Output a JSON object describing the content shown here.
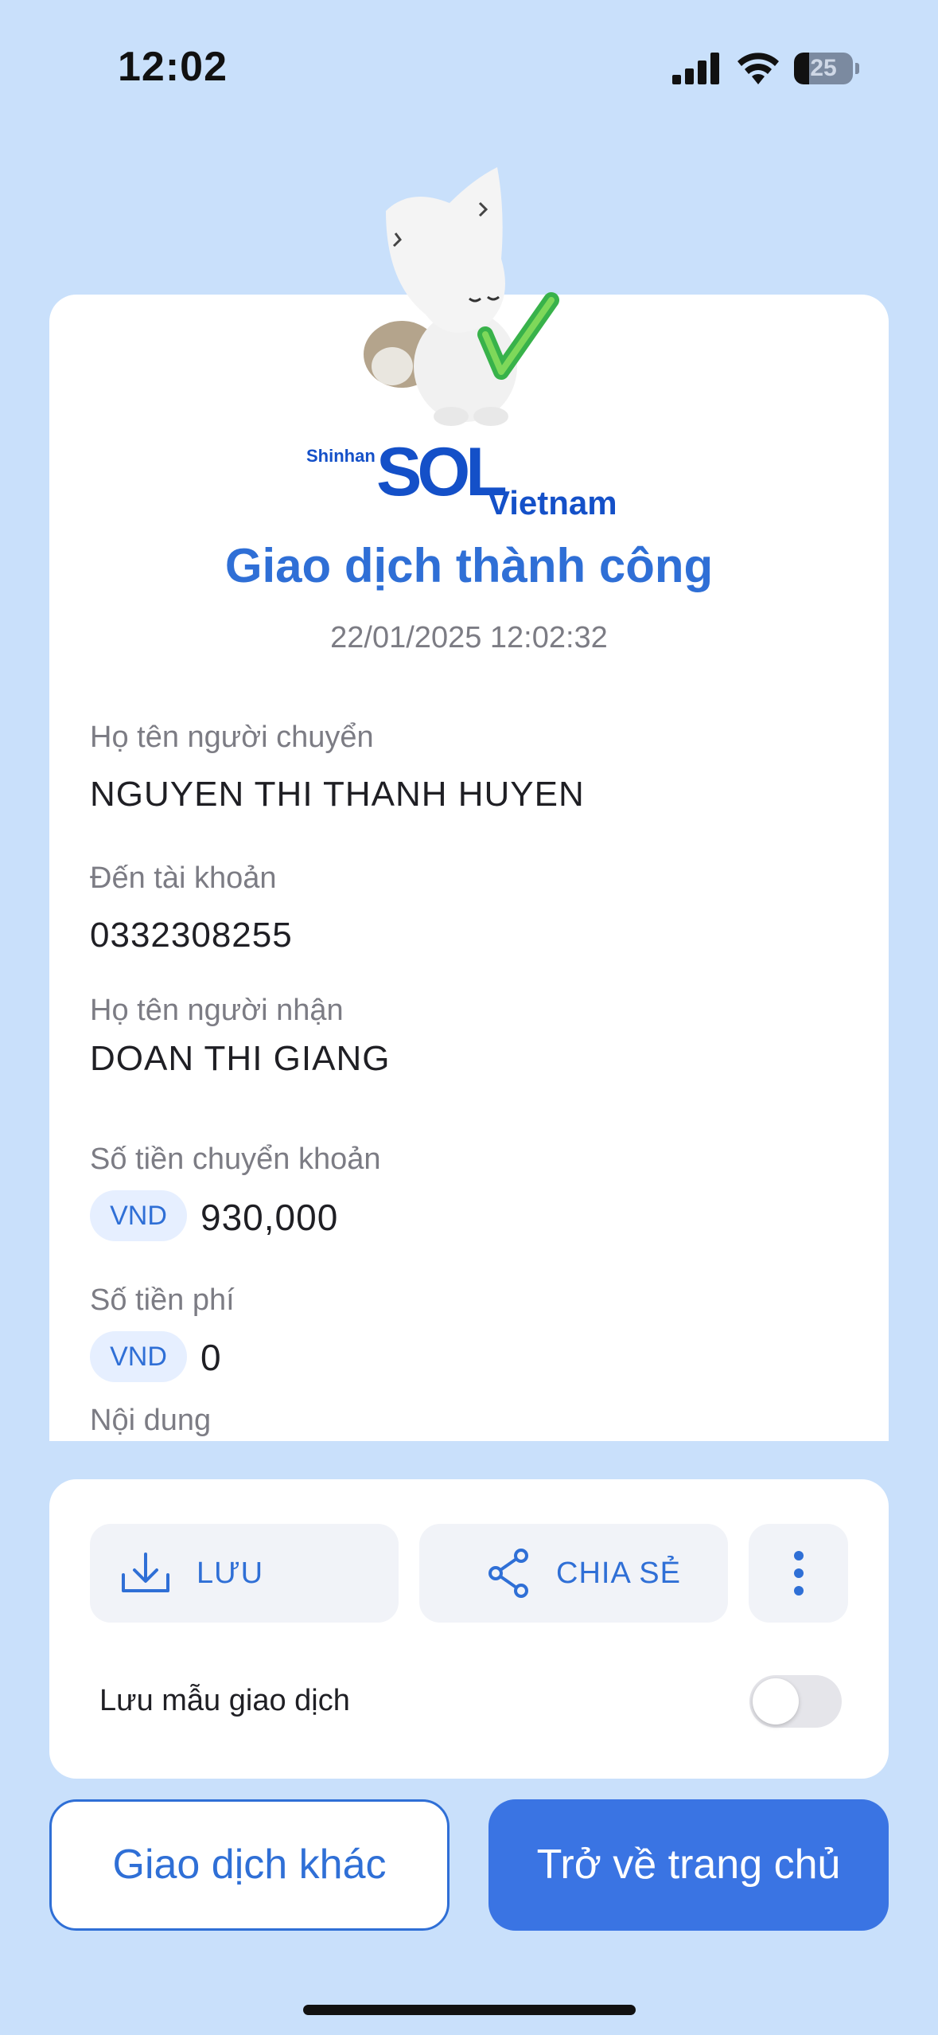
{
  "status_bar": {
    "time": "12:02",
    "battery": "25",
    "battery_level": 0.25
  },
  "receipt": {
    "brand": {
      "shinhan": "Shinhan",
      "sol": "SOL",
      "vietnam": "Vietnam"
    },
    "title": "Giao dịch thành công",
    "timestamp": "22/01/2025 12:02:32",
    "sender_label": "Họ tên người chuyển",
    "sender_value": "NGUYEN THI THANH HUYEN",
    "to_account_label": "Đến tài khoản",
    "to_account_value": "0332308255",
    "recipient_label": "Họ tên người nhận",
    "recipient_value": "DOAN THI GIANG",
    "amount_label": "Số tiền chuyển khoản",
    "amount_currency": "VND",
    "amount_value": "930,000",
    "fee_label": "Số tiền phí",
    "fee_currency": "VND",
    "fee_value": "0",
    "content_label": "Nội dung"
  },
  "actions": {
    "save_label": "LƯU",
    "share_label": "CHIA SẺ",
    "save_template_label": "Lưu mẫu giao dịch",
    "save_template_on": false
  },
  "footer": {
    "other_transaction_label": "Giao dịch khác",
    "home_label": "Trở về trang chủ"
  },
  "colors": {
    "background": "#c9e0fb",
    "accent": "#2f6fd6",
    "primary_button": "#3a74e3",
    "brand": "#1450c8"
  },
  "icons": [
    "signal-icon",
    "wifi-icon",
    "battery-icon",
    "download-icon",
    "share-icon",
    "more-vertical-icon"
  ]
}
